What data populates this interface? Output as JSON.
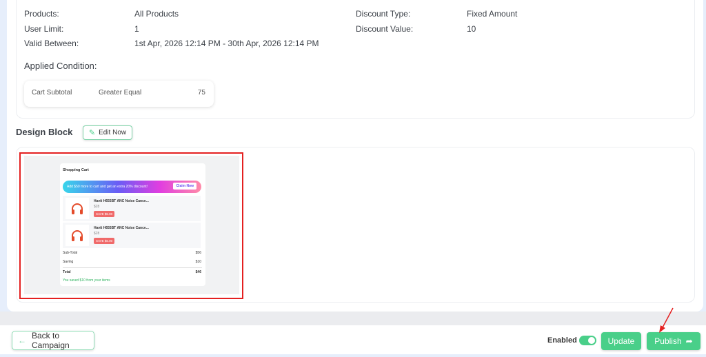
{
  "details": {
    "left": [
      {
        "label": "Products:",
        "value": "All Products"
      },
      {
        "label": "User Limit:",
        "value": "1"
      },
      {
        "label": "Valid Between:",
        "value": "1st Apr, 2026 12:14 PM - 30th Apr, 2026 12:14 PM"
      }
    ],
    "right": [
      {
        "label": "Discount Type:",
        "value": "Fixed Amount"
      },
      {
        "label": "Discount Value:",
        "value": "10"
      }
    ],
    "applied_condition_title": "Applied Condition:",
    "condition": {
      "field": "Cart Subtotal",
      "operator": "Greater Equal",
      "value": "75"
    }
  },
  "design_block": {
    "title": "Design Block",
    "edit_label": "Edit Now"
  },
  "cart_preview": {
    "title": "Shopping Cart",
    "banner_text": "Add $50 more to cart and get an extra 20% discount!",
    "claim_label": "Claim Now",
    "items": [
      {
        "name": "Havit H655BT ANC Noise Cance...",
        "price": "$28",
        "save": "SAVE $5.00"
      },
      {
        "name": "Havit H655BT ANC Noise Cance...",
        "price": "$28",
        "save": "SAVE $5.00"
      }
    ],
    "subtotal_label": "Sub-Total",
    "subtotal": "$56",
    "saving_label": "Saving",
    "saving": "$10",
    "total_label": "Total",
    "total": "$46",
    "saved_note": "You saved $10 from your items"
  },
  "footer": {
    "back_label": "Back to Campaign",
    "enabled_label": "Enabled",
    "enabled": true,
    "update_label": "Update",
    "publish_label": "Publish"
  },
  "colors": {
    "accent": "#49cf89",
    "highlight": "#e42020"
  }
}
